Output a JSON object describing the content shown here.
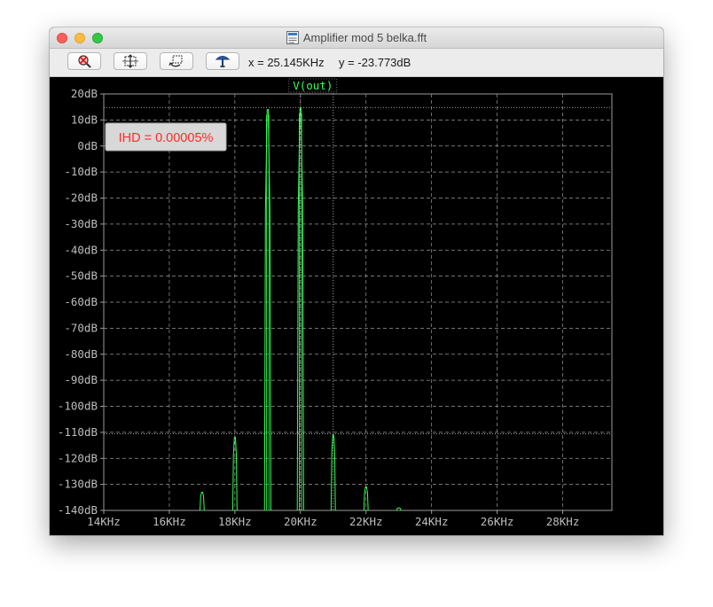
{
  "window": {
    "title": "Amplifier mod 5 belka.fft"
  },
  "toolbar": {
    "buttons": [
      {
        "icon": "autorange-icon"
      },
      {
        "icon": "zoom-extents-icon"
      },
      {
        "icon": "zoom-back-icon"
      },
      {
        "icon": "probe-icon"
      }
    ],
    "cursor_x": "x = 25.145KHz",
    "cursor_y": "y = -23.773dB"
  },
  "plot": {
    "trace_label": "V(out)",
    "annotation": "IHD = 0.00005%",
    "colors": {
      "background": "#000000",
      "trace": "#33ff55",
      "grid": "#9a9a9a",
      "axis_text": "#bdbdbd",
      "annotation_text": "#ff2a2a",
      "annotation_box": "#d8d8d8"
    }
  },
  "chart_data": {
    "type": "line",
    "title": "",
    "xlabel": "",
    "ylabel": "",
    "xlim": [
      14,
      29.5
    ],
    "ylim": [
      -140,
      20
    ],
    "x_ticks": [
      {
        "v": 14,
        "label": "14KHz"
      },
      {
        "v": 16,
        "label": "16KHz"
      },
      {
        "v": 18,
        "label": "18KHz"
      },
      {
        "v": 20,
        "label": "20KHz"
      },
      {
        "v": 22,
        "label": "22KHz"
      },
      {
        "v": 24,
        "label": "24KHz"
      },
      {
        "v": 26,
        "label": "26KHz"
      },
      {
        "v": 28,
        "label": "28KHz"
      }
    ],
    "y_ticks": [
      {
        "v": 20,
        "label": "20dB"
      },
      {
        "v": 10,
        "label": "10dB"
      },
      {
        "v": 0,
        "label": "0dB"
      },
      {
        "v": -10,
        "label": "-10dB"
      },
      {
        "v": -20,
        "label": "-20dB"
      },
      {
        "v": -30,
        "label": "-30dB"
      },
      {
        "v": -40,
        "label": "-40dB"
      },
      {
        "v": -50,
        "label": "-50dB"
      },
      {
        "v": -60,
        "label": "-60dB"
      },
      {
        "v": -70,
        "label": "-70dB"
      },
      {
        "v": -80,
        "label": "-80dB"
      },
      {
        "v": -90,
        "label": "-90dB"
      },
      {
        "v": -100,
        "label": "-100dB"
      },
      {
        "v": -110,
        "label": "-110dB"
      },
      {
        "v": -120,
        "label": "-120dB"
      },
      {
        "v": -130,
        "label": "-130dB"
      },
      {
        "v": -140,
        "label": "-140dB"
      }
    ],
    "grid": true,
    "series": [
      {
        "peaks": [
          {
            "x": 17.0,
            "y": -133
          },
          {
            "x": 18.0,
            "y": -112
          },
          {
            "x": 19.0,
            "y": 14
          },
          {
            "x": 20.0,
            "y": 14.5
          },
          {
            "x": 21.0,
            "y": -111
          },
          {
            "x": 22.0,
            "y": -131
          },
          {
            "x": 23.0,
            "y": -139
          }
        ],
        "floor": -140
      }
    ],
    "cursors": {
      "h": [
        14.8,
        -110.5
      ],
      "v": [
        20.0,
        21.0
      ]
    }
  }
}
